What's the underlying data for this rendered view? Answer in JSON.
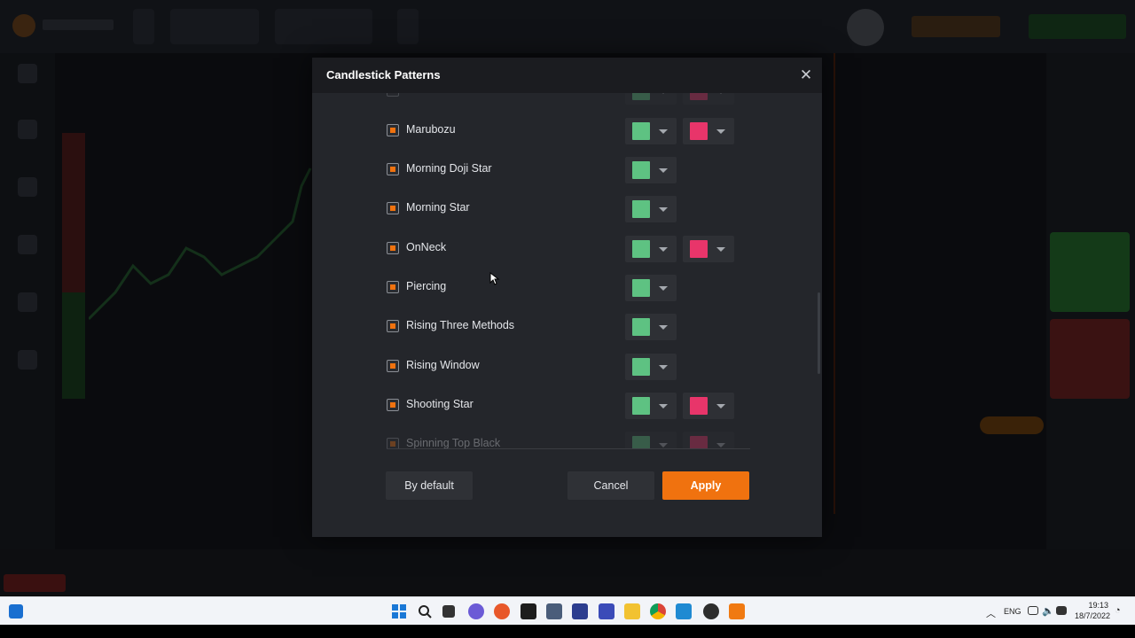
{
  "dialog": {
    "title": "Candlestick Patterns",
    "close_icon": "close-icon"
  },
  "patterns": [
    {
      "label": "",
      "checked": true,
      "bullish_color": "#5ec282",
      "bearish_color": "#e8356a",
      "faded": true
    },
    {
      "label": "Marubozu",
      "checked": true,
      "bullish_color": "#5ec282",
      "bearish_color": "#e8356a"
    },
    {
      "label": "Morning Doji Star",
      "checked": true,
      "bullish_color": "#5ec282"
    },
    {
      "label": "Morning Star",
      "checked": true,
      "bullish_color": "#5ec282"
    },
    {
      "label": "OnNeck",
      "checked": true,
      "bullish_color": "#5ec282",
      "bearish_color": "#e8356a"
    },
    {
      "label": "Piercing",
      "checked": true,
      "bullish_color": "#5ec282"
    },
    {
      "label": "Rising Three Methods",
      "checked": true,
      "bullish_color": "#5ec282"
    },
    {
      "label": "Rising Window",
      "checked": true,
      "bullish_color": "#5ec282"
    },
    {
      "label": "Shooting Star",
      "checked": true,
      "bullish_color": "#5ec282",
      "bearish_color": "#e8356a"
    },
    {
      "label": "Spinning Top Black",
      "checked": true,
      "bullish_color": "#5ec282",
      "bearish_color": "#e8356a",
      "faded": true
    }
  ],
  "buttons": {
    "by_default": "By default",
    "cancel": "Cancel",
    "apply": "Apply"
  },
  "colors": {
    "accent": "#f0720f",
    "bullish": "#5ec282",
    "bearish": "#e8356a"
  },
  "taskbar": {
    "language": "ENG",
    "time": "19:13",
    "date": "18/7/2022"
  }
}
